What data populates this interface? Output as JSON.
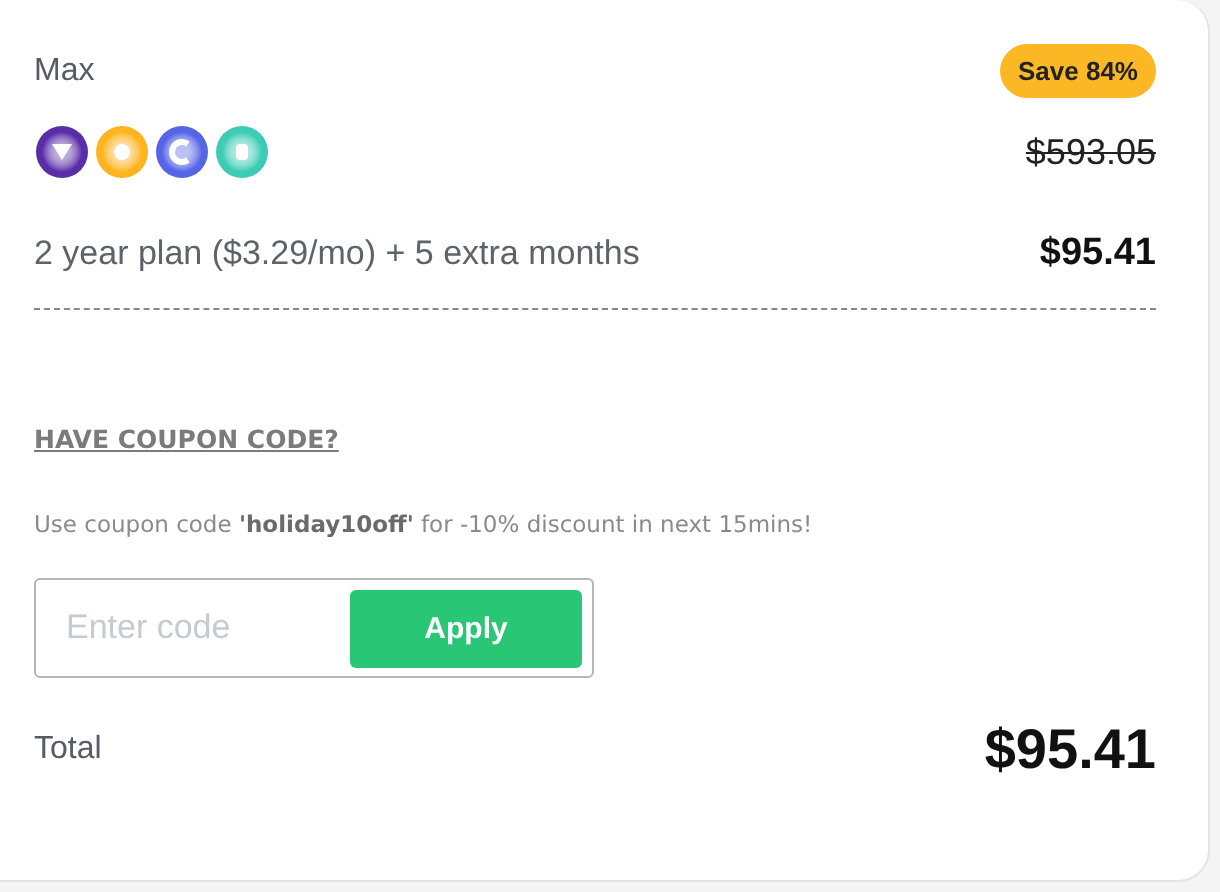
{
  "plan": {
    "name": "Max",
    "badge": "Save 84%",
    "apps": [
      {
        "color": "#5a2ca8"
      },
      {
        "color": "#ffb31f"
      },
      {
        "color": "#5664e6"
      },
      {
        "color": "#3ccbb5"
      }
    ],
    "old_price": "$593.05",
    "term": "2 year plan ($3.29/mo) + 5 extra months",
    "price": "$95.41"
  },
  "coupon": {
    "heading": "HAVE COUPON CODE?",
    "note": "Use coupon code **'holiday10off'** for -10% discount in next 15mins!",
    "placeholder": "Enter code",
    "button": "Apply"
  },
  "total": {
    "label": "Total",
    "amount": "$95.41"
  }
}
